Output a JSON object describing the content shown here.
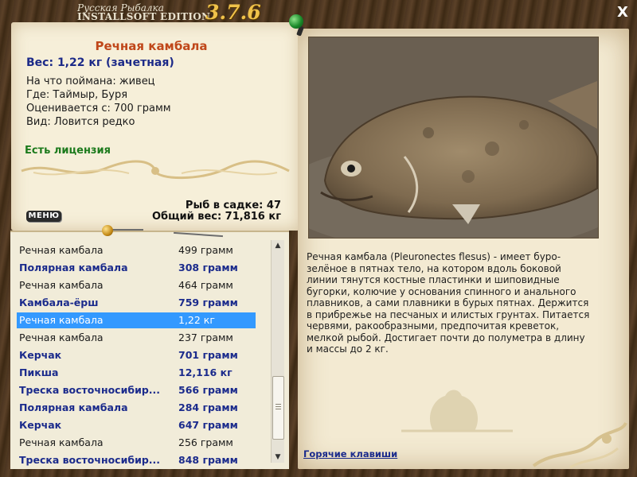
{
  "app": {
    "title_line1": "Русская Рыбалка",
    "title_line2": "INSTALLSOFT EDITION",
    "version": "3.7.6",
    "close_label": "X"
  },
  "fish_card": {
    "name": "Речная камбала",
    "weight": "Вес: 1,22 кг (зачетная)",
    "bait": "На что поймана: живец",
    "location": "Где: Таймыр, Буря",
    "valued_from": "Оценивается с: 700 грамм",
    "rarity": "Вид: Ловится редко",
    "license": "Есть лицензия",
    "fish_in_keepnet": "Рыб в садке: 47",
    "total_weight": "Общий вес: 71,816 кг",
    "menu_label": "МЕНЮ"
  },
  "catch_list": [
    {
      "name": "Речная камбала",
      "weight": "499 грамм",
      "style": "plain"
    },
    {
      "name": "Полярная камбала",
      "weight": "308 грамм",
      "style": "bold"
    },
    {
      "name": "Речная камбала",
      "weight": "464 грамм",
      "style": "plain"
    },
    {
      "name": "Камбала-ёрш",
      "weight": "759 грамм",
      "style": "bold"
    },
    {
      "name": "Речная камбала",
      "weight": "1,22 кг",
      "style": "selected"
    },
    {
      "name": "Речная камбала",
      "weight": "237 грамм",
      "style": "plain"
    },
    {
      "name": "Керчак",
      "weight": "701 грамм",
      "style": "bold"
    },
    {
      "name": "Пикша",
      "weight": "12,116 кг",
      "style": "bold"
    },
    {
      "name": "Треска восточносибир...",
      "weight": "566 грамм",
      "style": "bold"
    },
    {
      "name": "Полярная камбала",
      "weight": "284 грамм",
      "style": "bold"
    },
    {
      "name": "Керчак",
      "weight": "647 грамм",
      "style": "bold"
    },
    {
      "name": "Речная камбала",
      "weight": "256 грамм",
      "style": "plain"
    },
    {
      "name": "Треска восточносибир...",
      "weight": "848 грамм",
      "style": "bold"
    }
  ],
  "description": "Речная камбала (Pleuronectes flesus) - имеет буро-зелёное в пятнах тело, на котором вдоль боковой линии тянутся костные пластинки и шиповидные бугорки, колючие у основания спинного и анального плавников, а сами плавники в бурых пятнах. Держится в прибрежье на песчаных и илистых грунтах. Питается червями, ракообразными, предпочитая креветок, мелкой рыбой. Достигает почти до полуметра в длину и массы до 2 кг.",
  "hotkeys_link": "Горячие клавиши",
  "colors": {
    "title_red": "#c0471a",
    "weight_blue": "#1c2a88",
    "license_green": "#1c7a1c",
    "selection_blue": "#3399ff",
    "version_gold": "#f0c24a"
  },
  "icons": {
    "close": "close-icon",
    "scroll_up": "arrow-up-icon",
    "scroll_down": "arrow-down-icon"
  }
}
